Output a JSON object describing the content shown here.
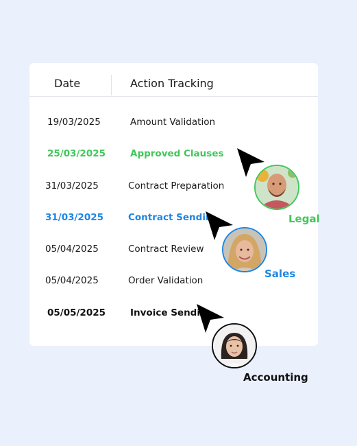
{
  "colors": {
    "background": "#ebf0fd",
    "legal_green": "#41c75a",
    "sales_blue": "#1e86e4",
    "accounting_black": "#111111"
  },
  "table": {
    "header": {
      "date": "Date",
      "action": "Action Tracking"
    },
    "rows": [
      {
        "date": "19/03/2025",
        "action": "Amount Validation",
        "style": "normal"
      },
      {
        "date": "25/03/2025",
        "action": "Approved Clauses",
        "style": "legal"
      },
      {
        "date": "31/03/2025",
        "action": "Contract Preparation",
        "style": "normal"
      },
      {
        "date": "31/03/2025",
        "action": "Contract Sending",
        "style": "sales"
      },
      {
        "date": "05/04/2025",
        "action": "Contract Review",
        "style": "normal"
      },
      {
        "date": "05/04/2025",
        "action": "Order Validation",
        "style": "normal"
      },
      {
        "date": "05/05/2025",
        "action": "Invoice Sending",
        "style": "accounting"
      }
    ]
  },
  "collaborators": {
    "legal": {
      "label": "Legal",
      "avatar_icon": "bearded-man-avatar-icon"
    },
    "sales": {
      "label": "Sales",
      "avatar_icon": "blonde-woman-avatar-icon"
    },
    "accounting": {
      "label": "Accounting",
      "avatar_icon": "dark-haired-woman-avatar-icon"
    }
  }
}
